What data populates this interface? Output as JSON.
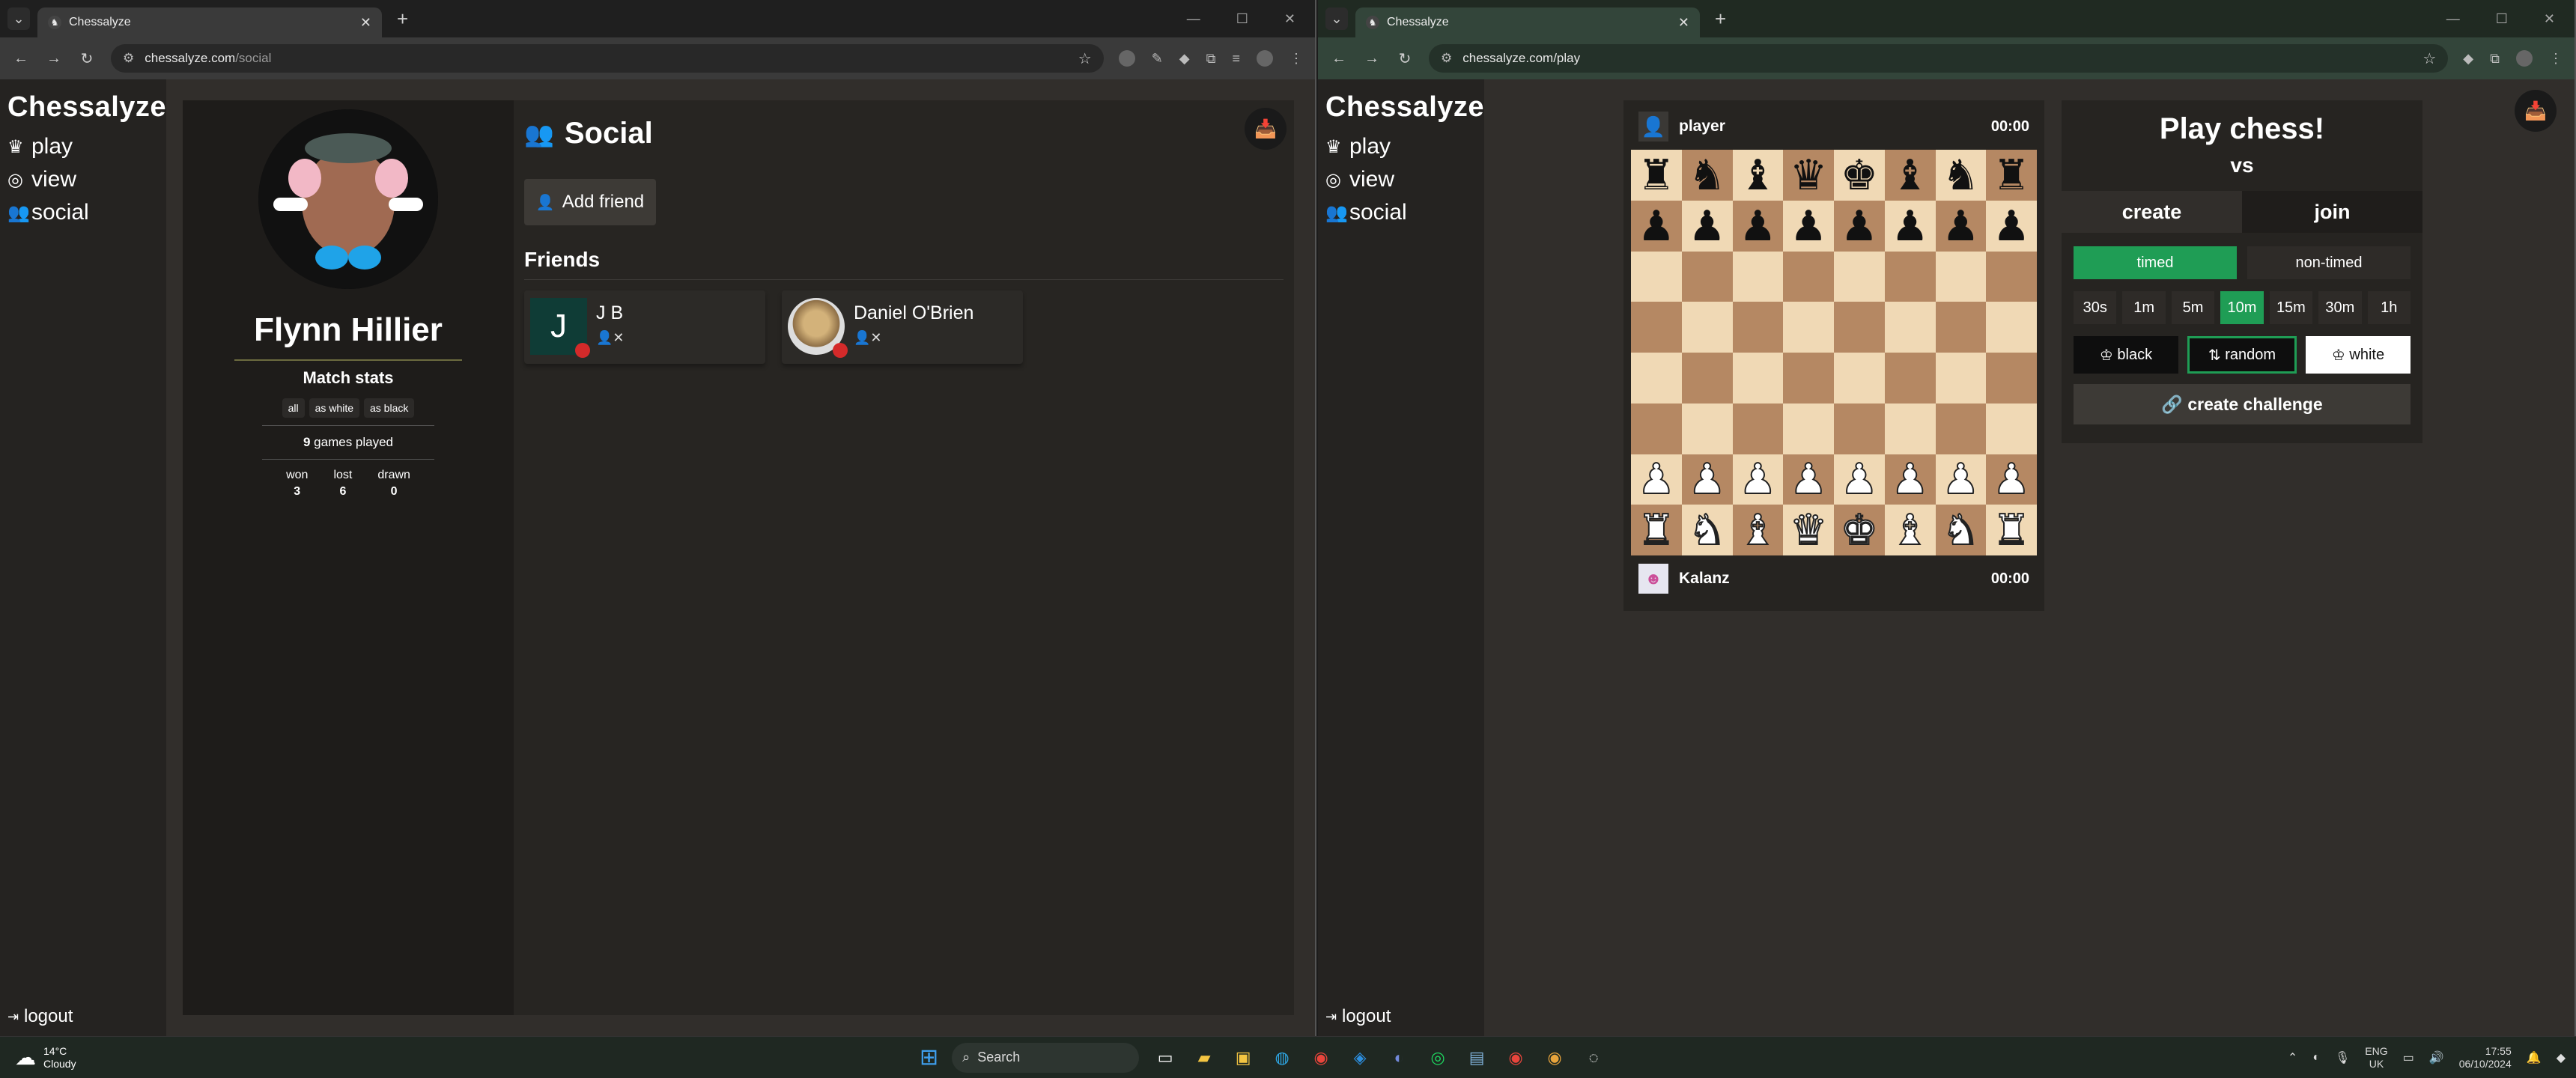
{
  "left_window": {
    "tab_title": "Chessalyze",
    "url_host": "chessalyze.com",
    "url_path": "/social"
  },
  "right_window": {
    "tab_title": "Chessalyze",
    "url_host": "chessalyze.com",
    "url_path": "/play"
  },
  "sidebar": {
    "brand": "Chessalyze",
    "items": [
      {
        "label": "play",
        "icon": "crown-icon"
      },
      {
        "label": "view",
        "icon": "binoculars-icon"
      },
      {
        "label": "social",
        "icon": "users-icon"
      }
    ],
    "logout": "logout"
  },
  "profile": {
    "name": "Flynn Hillier",
    "match_stats_label": "Match stats",
    "filters": [
      "all",
      "as white",
      "as black"
    ],
    "games_played_count": "9",
    "games_played_label": "games played",
    "won_label": "won",
    "lost_label": "lost",
    "drawn_label": "drawn",
    "won": "3",
    "lost": "6",
    "drawn": "0"
  },
  "social": {
    "title": "Social",
    "add_friend": "Add friend",
    "friends_title": "Friends",
    "friends": [
      {
        "name": "J B",
        "initial": "J",
        "status_color": "#d42a2a"
      },
      {
        "name": "Daniel O'Brien",
        "initial": "",
        "status_color": "#d42a2a"
      }
    ]
  },
  "game": {
    "top_player": "player",
    "top_clock": "00:00",
    "bottom_player": "Kalanz",
    "bottom_clock": "00:00",
    "board": [
      [
        "♜",
        "♞",
        "♝",
        "♛",
        "♚",
        "♝",
        "♞",
        "♜"
      ],
      [
        "♟",
        "♟",
        "♟",
        "♟",
        "♟",
        "♟",
        "♟",
        "♟"
      ],
      [
        "",
        "",
        "",
        "",
        "",
        "",
        "",
        ""
      ],
      [
        "",
        "",
        "",
        "",
        "",
        "",
        "",
        ""
      ],
      [
        "",
        "",
        "",
        "",
        "",
        "",
        "",
        ""
      ],
      [
        "",
        "",
        "",
        "",
        "",
        "",
        "",
        ""
      ],
      [
        "♙",
        "♙",
        "♙",
        "♙",
        "♙",
        "♙",
        "♙",
        "♙"
      ],
      [
        "♖",
        "♘",
        "♗",
        "♕",
        "♔",
        "♗",
        "♘",
        "♖"
      ]
    ]
  },
  "play_panel": {
    "title": "Play chess!",
    "vs": "vs",
    "tab_create": "create",
    "tab_join": "join",
    "timed": "timed",
    "non_timed": "non-timed",
    "times": [
      "30s",
      "1m",
      "5m",
      "10m",
      "15m",
      "30m",
      "1h"
    ],
    "selected_time": "10m",
    "color_black": "black",
    "color_random": "random",
    "color_white": "white",
    "create_challenge": "create challenge"
  },
  "taskbar": {
    "temp": "14°C",
    "weather": "Cloudy",
    "search": "Search",
    "lang_top": "ENG",
    "lang_bottom": "UK",
    "time": "17:55",
    "date": "06/10/2024"
  },
  "colors": {
    "accent_green": "#1f9d55",
    "status_red": "#d42a2a"
  }
}
